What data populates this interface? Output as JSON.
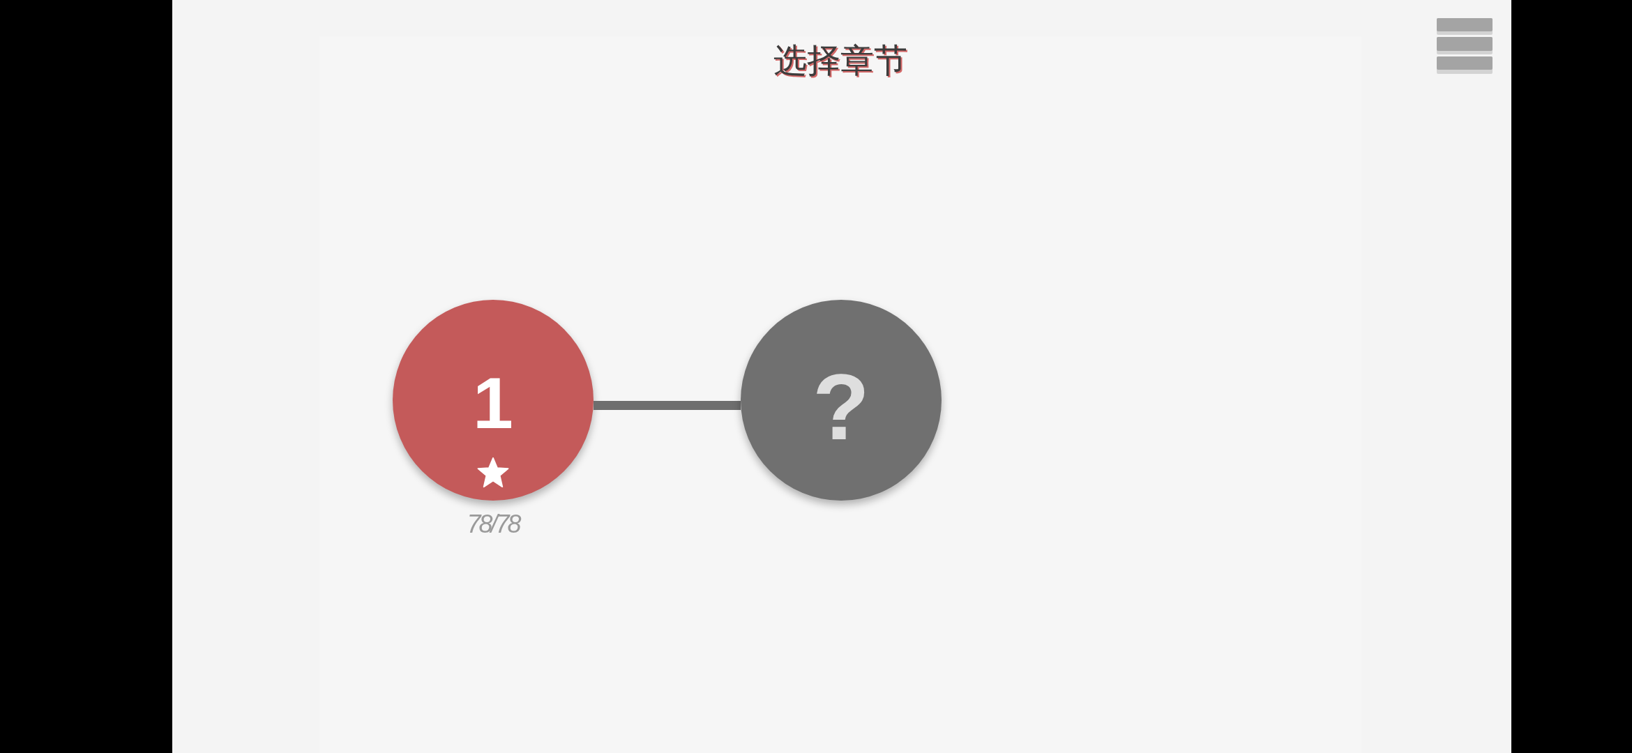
{
  "title": "选择章节",
  "chapters": [
    {
      "label": "1",
      "locked": false,
      "completed": true,
      "progress": "78/78"
    },
    {
      "label": "?",
      "locked": true,
      "completed": false
    }
  ]
}
